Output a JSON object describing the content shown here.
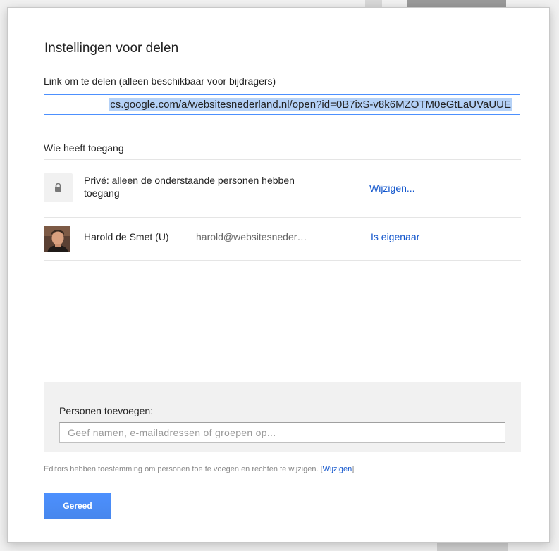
{
  "dialog": {
    "title": "Instellingen voor delen",
    "link_label": "Link om te delen (alleen beschikbaar voor bijdragers)",
    "link_value": "cs.google.com/a/websitesnederland.nl/open?id=0B7ixS-v8k6MZOTM0eGtLaUVaUUE",
    "access_heading": "Wie heeft toegang",
    "visibility": {
      "icon": "lock-icon",
      "text": "Privé: alleen de onderstaande personen hebben toegang",
      "change_link": "Wijzigen..."
    },
    "people": [
      {
        "name": "Harold de Smet (U)",
        "email": "harold@websitesneder…",
        "role": "Is eigenaar"
      }
    ],
    "add_people": {
      "label": "Personen toevoegen:",
      "placeholder": "Geef namen, e-mailadressen of groepen op..."
    },
    "editors_note": {
      "text": "Editors hebben toestemming om personen toe te voegen en rechten te wijzigen.",
      "bracket_open": "[",
      "link": "Wijzigen",
      "bracket_close": "]"
    },
    "done_button": "Gereed"
  },
  "colors": {
    "accent_blue": "#4d90fe",
    "link_blue": "#1155cc",
    "selection": "#b4d1f7",
    "panel_gray": "#f1f1f1"
  }
}
